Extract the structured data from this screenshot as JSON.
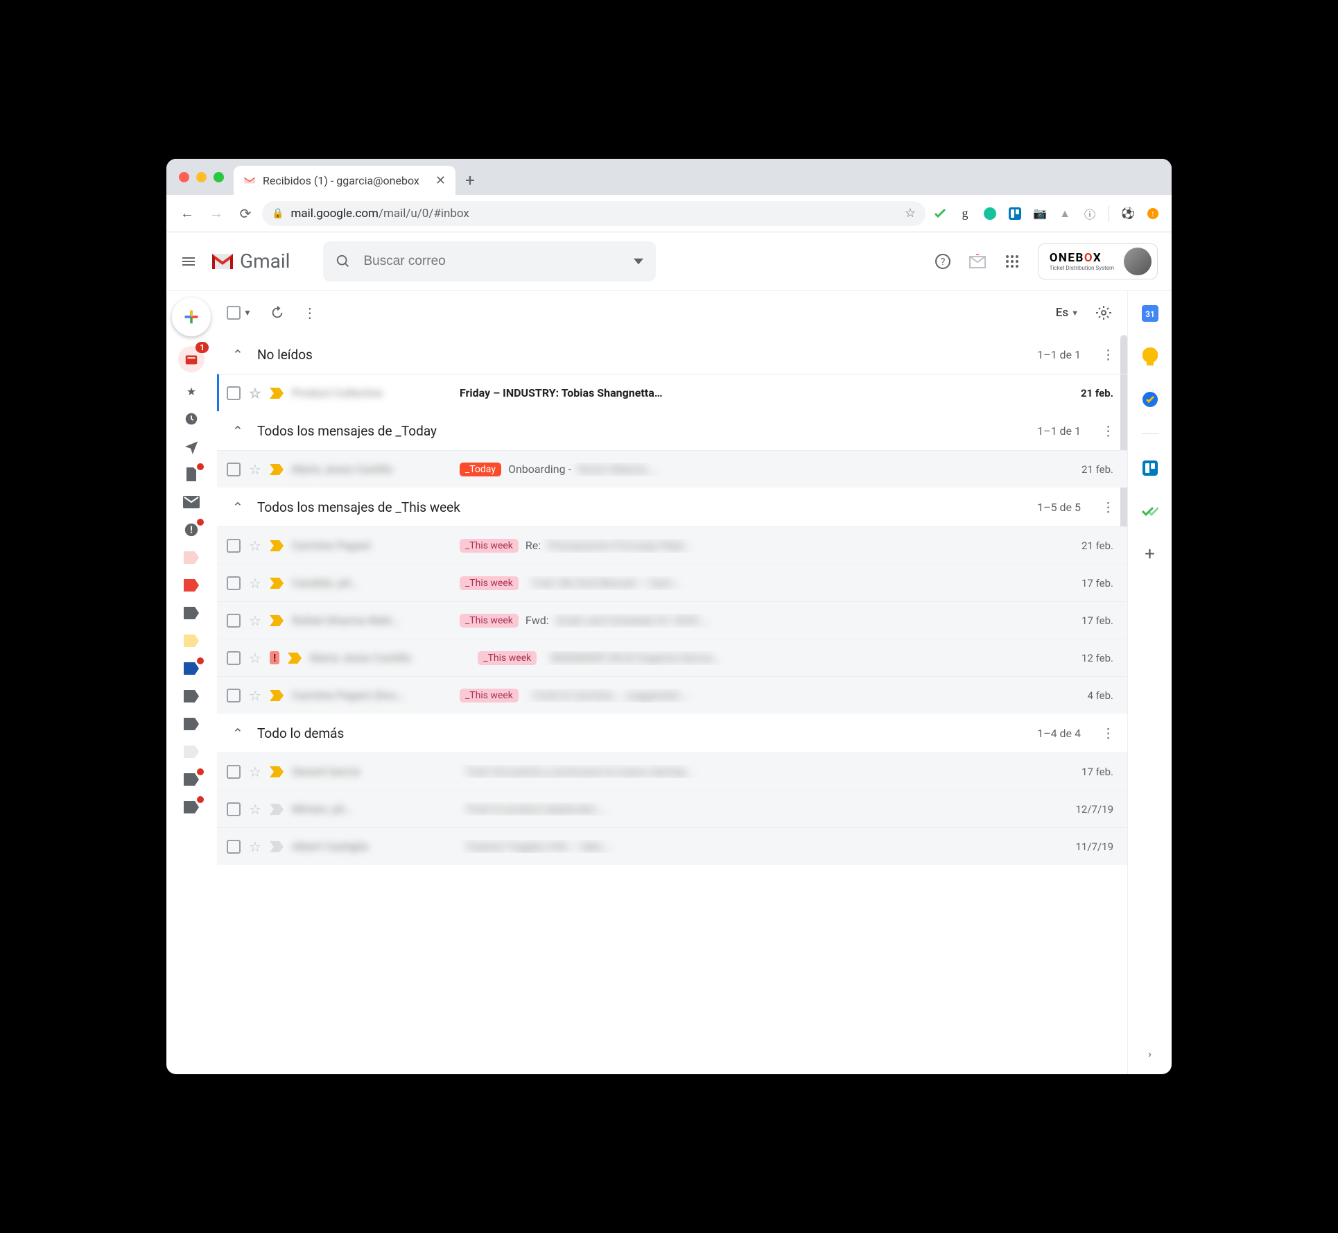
{
  "browser": {
    "tab_title": "Recibidos (1) - ggarcia@onebox",
    "url_domain": "mail.google.com",
    "url_path": "/mail/u/0/#inbox"
  },
  "header": {
    "product": "Gmail",
    "search_placeholder": "Buscar correo",
    "input_tools_label": "Es",
    "brand_text": "ONEBOX",
    "brand_sub": "Ticket Distribution System"
  },
  "sidebar_badge": "1",
  "sections": [
    {
      "title": "No leídos",
      "count": "1–1 de 1",
      "rows": [
        {
          "unread": true,
          "starred": false,
          "important": "gold",
          "sender": "Product Collective",
          "label": null,
          "subject": "Friday – INDUSTRY: Tobias Shangnetta…",
          "date": "21 feb."
        }
      ]
    },
    {
      "title": "Todos los mensajes de _Today",
      "count": "1–1 de 1",
      "rows": [
        {
          "unread": false,
          "shaded": true,
          "important": "gold",
          "sender": "María Jesús Castillo",
          "label": "_Today",
          "labelStyle": "today",
          "subject": "Onboarding - ",
          "subject_tail": "Rocío Obenza …",
          "date": "21 feb."
        }
      ]
    },
    {
      "title": "Todos los mensajes de _This week",
      "count": "1–5 de 5",
      "rows": [
        {
          "shaded": true,
          "important": "gold",
          "sender": "Carmine Pagani",
          "label": "_This week",
          "labelStyle": "week",
          "subject": "Re: ",
          "subject_tail": "Presupuesto Procargo Repl…",
          "date": "21 feb."
        },
        {
          "shaded": true,
          "important": "gold",
          "sender": "Candido, pil…",
          "label": "_This week",
          "labelStyle": "week",
          "subject": "",
          "subject_tail": "Fwd: We find Manuel — Sam…",
          "date": "17 feb."
        },
        {
          "shaded": true,
          "important": "gold",
          "sender": "Rafael Gharma-Babi…",
          "label": "_This week",
          "labelStyle": "week",
          "subject": "Fwd: ",
          "subject_tail": "Goals and Schedule Q1 2020 …",
          "date": "17 feb."
        },
        {
          "shaded": true,
          "important": "gold",
          "bang": true,
          "sender": "María Jesús Castillo",
          "label": "_This week",
          "labelStyle": "week",
          "subject": "",
          "subject_tail": "REMINDER ORJE Eugenia García…",
          "date": "12 feb."
        },
        {
          "shaded": true,
          "important": "gold",
          "sender": "Carmine Pagani (Doc…",
          "label": "_This week",
          "labelStyle": "week",
          "subject": "",
          "subject_tail": "Cristi & Carmine … suggested …",
          "date": "4 feb."
        }
      ]
    },
    {
      "title": "Todo lo demás",
      "count": "1–4 de 4",
      "rows": [
        {
          "shaded": true,
          "important": "gold",
          "sender": "Gerard García",
          "label": null,
          "subject": "",
          "subject_tail": "Fwd: Encuentra y promueve la nueva startup…",
          "date": "17 feb."
        },
        {
          "shaded": true,
          "important": "grey",
          "sender": "Miriam, pil…",
          "label": null,
          "subject": "",
          "subject_tail": "Push & product playbooks …",
          "date": "12/7/19"
        },
        {
          "shaded": true,
          "important": "grey",
          "sender": "Albert Castiglia",
          "label": null,
          "subject": "",
          "subject_tail": "Feature Toggles Info – take …",
          "date": "11/7/19"
        }
      ]
    }
  ]
}
